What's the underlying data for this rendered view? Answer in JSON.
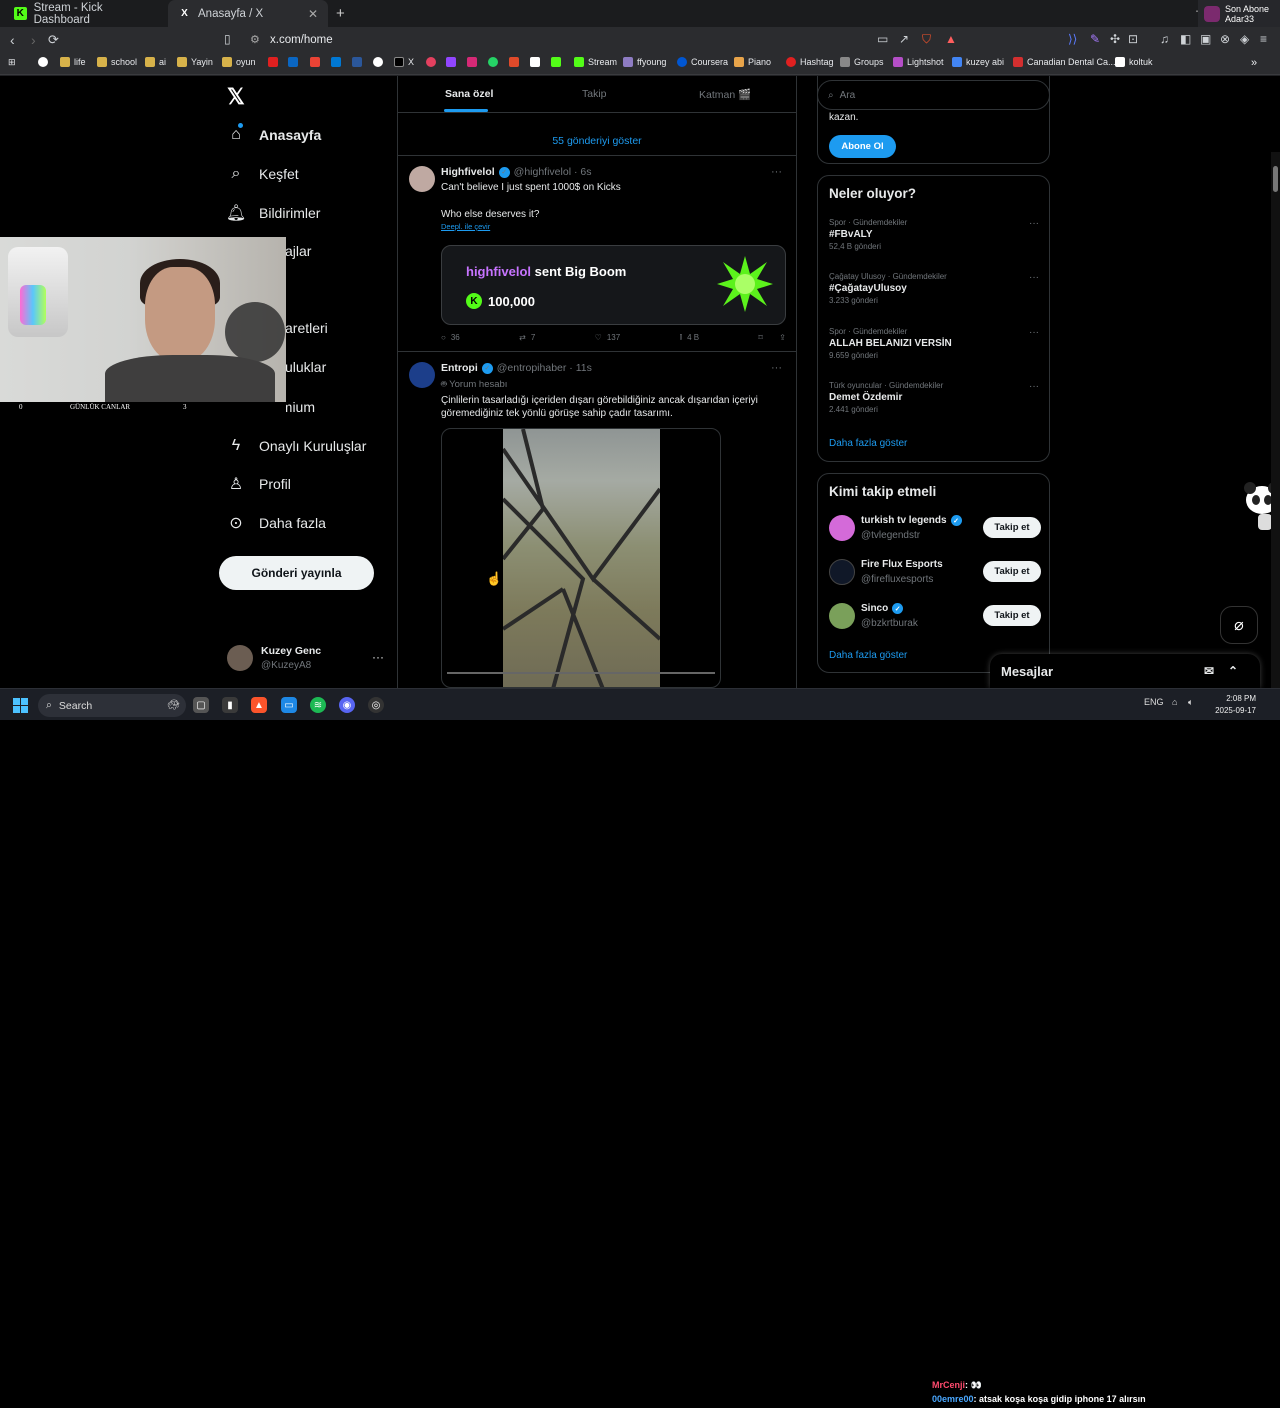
{
  "browser": {
    "tabs": [
      {
        "label": "Stream - Kick Dashboard",
        "favicon": "K"
      },
      {
        "label": "Anasayfa / X",
        "favicon": "X"
      }
    ],
    "url": "x.com/home",
    "extension_widget": {
      "line1": "Son Abone",
      "line2": "Adar33"
    },
    "bookmarks": [
      "life",
      "school",
      "ai",
      "Yayin",
      "oyun",
      "X",
      "Stream",
      "ffyoung",
      "Coursera",
      "Piano",
      "Hashtag",
      "Groups",
      "Lightshot",
      "kuzey abi",
      "Canadian Dental Ca...",
      "koltuk"
    ]
  },
  "sidebar": {
    "items": [
      {
        "label": "Anasayfa",
        "icon": "home-icon"
      },
      {
        "label": "Keşfet",
        "icon": "search-icon"
      },
      {
        "label": "Bildirimler",
        "icon": "bell-icon"
      },
      {
        "label": "ajlar",
        "icon": "mail-icon"
      },
      {
        "label": "aretleri",
        "icon": "bookmark-icon"
      },
      {
        "label": "uluklar",
        "icon": "community-icon"
      },
      {
        "label": "Premium",
        "icon": "x-premium-icon"
      },
      {
        "label": "Onaylı Kuruluşlar",
        "icon": "lightning-icon"
      },
      {
        "label": "Profil",
        "icon": "person-icon"
      },
      {
        "label": "Daha fazla",
        "icon": "more-circle-icon"
      }
    ],
    "post_button": "Gönderi yayınla",
    "profile": {
      "name": "Kuzey Genc",
      "handle": "@KuzeyA8"
    }
  },
  "webcam_overlay": {
    "left": "0",
    "center": "GÜNLÜK CANLAR",
    "right": "3"
  },
  "feed": {
    "tabs": [
      "Sana özel",
      "Takip",
      "Katman 🎬"
    ],
    "show_more": "55 gönderiyi göster",
    "tweets": [
      {
        "name": "Highfivelol",
        "handle": "@highfivelol · 6s",
        "text1": "Can't believe I just spent 1000$ on Kicks",
        "text2": "Who else deserves it?",
        "translate": "Deepl. ile çevir",
        "card": {
          "user": "highfivelol",
          "action": "sent Big Boom",
          "amount": "100,000"
        },
        "actions": {
          "replies": "36",
          "reposts": "7",
          "likes": "137",
          "views": "4 B"
        }
      },
      {
        "name": "Entropi",
        "handle": "@entropihaber · 11s",
        "context": "Yorum hesabı",
        "text": "Çinlilerin tasarladığı içeriden dışarı görebildiğiniz ancak dışarıdan içeriyi göremediğiniz tek yönlü görüşe sahip çadır tasarımı."
      }
    ]
  },
  "right": {
    "search_placeholder": "Ara",
    "premium_text": "kazan.",
    "subscribe_button": "Abone Ol",
    "trends_title": "Neler oluyor?",
    "trends": [
      {
        "category": "Spor · Gündemdekiler",
        "name": "#FBvALY",
        "count": "52,4 B gönderi"
      },
      {
        "category": "Çağatay Ulusoy · Gündemdekiler",
        "name": "#ÇağatayUlusoy",
        "count": "3.233 gönderi"
      },
      {
        "category": "Spor · Gündemdekiler",
        "name": "ALLAH BELANIZI VERSİN",
        "count": "9.659 gönderi"
      },
      {
        "category": "Türk oyuncular · Gündemdekiler",
        "name": "Demet Özdemir",
        "count": "2.441 gönderi"
      }
    ],
    "trends_more": "Daha fazla göster",
    "follow_title": "Kimi takip etmeli",
    "follow": [
      {
        "name": "turkish tv legends",
        "handle": "@tvlegendstr",
        "button": "Takip et"
      },
      {
        "name": "Fire Flux Esports",
        "handle": "@firefluxesports",
        "button": "Takip et"
      },
      {
        "name": "Sinco",
        "handle": "@bzkrtburak",
        "button": "Takip et"
      }
    ],
    "follow_more": "Daha fazla göster"
  },
  "messages_label": "Mesajlar",
  "taskbar": {
    "search": "Search",
    "chat": [
      {
        "user": "MrCenji",
        "text": ": 👀"
      },
      {
        "user": "00emre00",
        "text": ": atsak koşa koşa gidip iphone 17 alırsın"
      }
    ],
    "lang": "ENG",
    "time": "2:08 PM",
    "date": "2025-09-17"
  }
}
